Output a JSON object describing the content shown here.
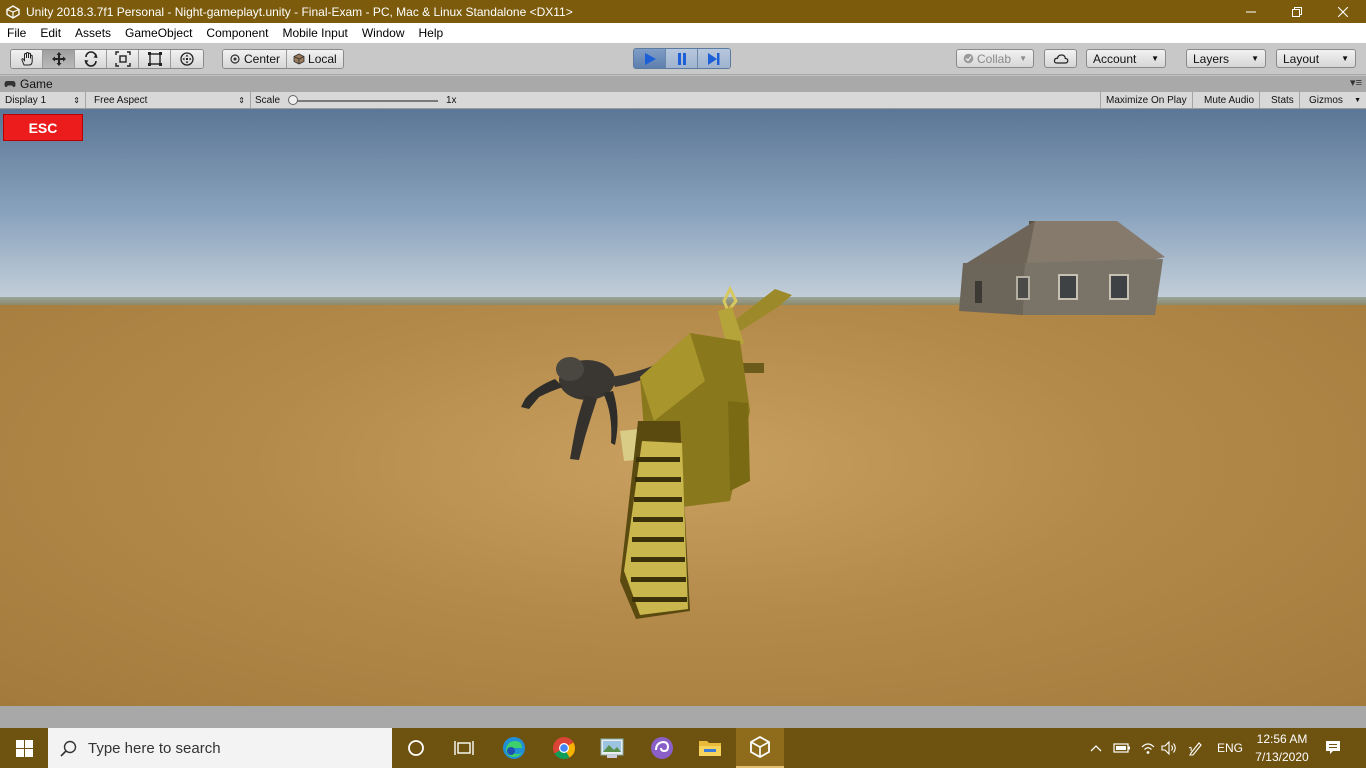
{
  "window": {
    "title": "Unity 2018.3.7f1 Personal - Night-gameplayt.unity - Final-Exam - PC, Mac & Linux Standalone <DX11>",
    "controls": [
      "minimize",
      "restore",
      "close"
    ]
  },
  "menu": {
    "items": [
      "File",
      "Edit",
      "Assets",
      "GameObject",
      "Component",
      "Mobile Input",
      "Window",
      "Help"
    ]
  },
  "toolbar": {
    "tools": [
      "hand-tool",
      "move-tool",
      "rotate-tool",
      "scale-tool",
      "rect-tool",
      "transform-tool"
    ],
    "active_tool": "move-tool",
    "pivot_label": "Center",
    "space_label": "Local",
    "play_state": "playing",
    "collab_label": "Collab",
    "account_label": "Account",
    "layers_label": "Layers",
    "layout_label": "Layout"
  },
  "game_tab": {
    "label": "Game"
  },
  "game_bar": {
    "display": "Display 1",
    "aspect": "Free Aspect",
    "scale_label": "Scale",
    "scale_value": "1x",
    "scale_fraction": 0.0,
    "maximize_label": "Maximize On Play",
    "mute_label": "Mute Audio",
    "stats_label": "Stats",
    "gizmos_label": "Gizmos"
  },
  "game": {
    "esc_label": "ESC",
    "colors": {
      "esc_bg": "#ec1c1c",
      "sky": "#6d87a6",
      "ground": "#b88e4e",
      "weapon": "#b39a1e"
    }
  },
  "taskbar": {
    "search_placeholder": "Type here to search",
    "apps": [
      "cortana-icon",
      "task-view-icon",
      "edge-icon",
      "chrome-icon",
      "photos-icon",
      "app-icon",
      "file-explorer-icon",
      "unity-icon"
    ],
    "language": "ENG",
    "time": "12:56 AM",
    "date": "7/13/2020"
  }
}
